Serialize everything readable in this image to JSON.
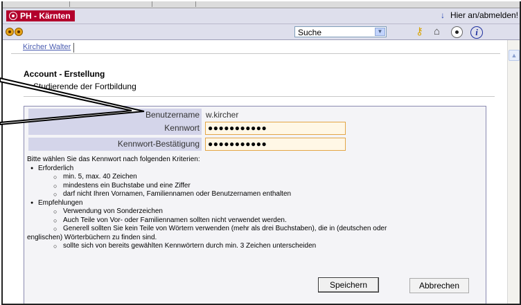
{
  "header": {
    "logo_text": "PH - Kärnten",
    "login_arrow": "↓",
    "login_label": "Hier an/abmelden!"
  },
  "toolbar": {
    "search_select_value": "Suche",
    "select_arrow": "▼",
    "icons": [
      "back-icon",
      "forward-icon",
      "key-icon",
      "home-icon",
      "moon-icon",
      "info-icon"
    ],
    "info_glyph": "i"
  },
  "tab": {
    "label": "Kircher Walter"
  },
  "page": {
    "title": "Account - Erstellung",
    "subtitle": "Studierende der Fortbildung"
  },
  "form": {
    "username_label": "Benutzername",
    "username_value": "w.kircher",
    "password_label": "Kennwort",
    "password_value": "●●●●●●●●●●●",
    "confirm_label": "Kennwort-Bestätigung",
    "confirm_value": "●●●●●●●●●●●"
  },
  "criteria": {
    "intro": "Bitte wählen Sie das Kennwort nach folgenden Kriterien:",
    "required_label": "Erforderlich",
    "required_items": [
      "min. 5, max. 40 Zeichen",
      "mindestens ein Buchstabe und eine Ziffer",
      "darf nicht Ihren Vornamen, Familiennamen oder Benutzernamen enthalten"
    ],
    "recommended_label": "Empfehlungen",
    "recommended_items": [
      "Verwendung von Sonderzeichen",
      "Auch Teile von Vor- oder Familiennamen sollten nicht verwendet werden.",
      "Generell sollten Sie kein Teile von Wörtern verwenden (mehr als drei Buchstaben), die in (deutschen oder",
      "englischen) Wörterbüchern zu finden sind.",
      "sollte sich von bereits gewählten Kennwörtern durch min. 3 Zeichen unterscheiden"
    ]
  },
  "buttons": {
    "save_label": "Speichern",
    "cancel_label": "Abbrechen"
  },
  "colors": {
    "brand": "#b3002c",
    "chrome": "#dedfec",
    "label_bg": "#d4d5ea",
    "input_border": "#e3a546"
  }
}
